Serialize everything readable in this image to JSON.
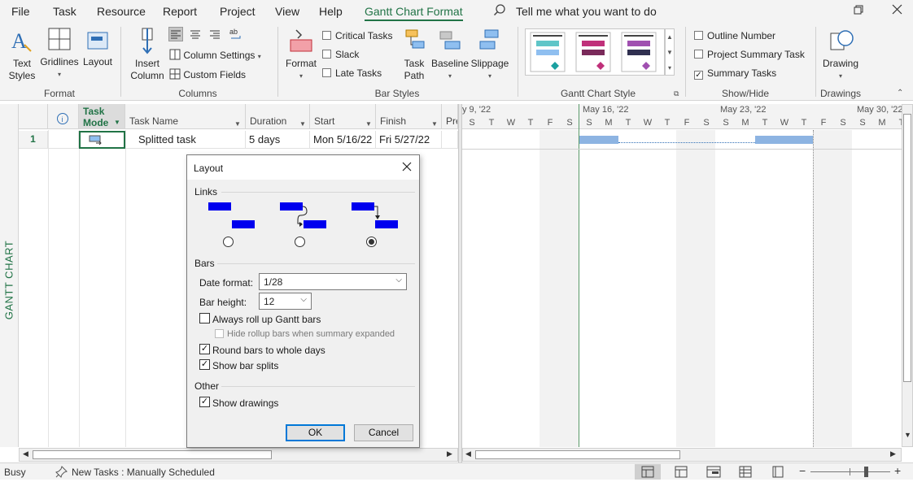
{
  "menu": {
    "items": [
      "File",
      "Task",
      "Resource",
      "Report",
      "Project",
      "View",
      "Help",
      "Gantt Chart Format"
    ],
    "tell_me": "Tell me what you want to do"
  },
  "ribbon": {
    "format_group": {
      "label": "Format",
      "text_styles": "Text\nStyles",
      "gridlines": "Gridlines",
      "layout": "Layout"
    },
    "columns_group": {
      "label": "Columns",
      "insert_column": "Insert\nColumn",
      "column_settings": "Column Settings",
      "custom_fields": "Custom Fields"
    },
    "bar_styles_group": {
      "label": "Bar Styles",
      "format": "Format",
      "critical_tasks": "Critical Tasks",
      "slack": "Slack",
      "late_tasks": "Late Tasks",
      "task_path": "Task\nPath",
      "baseline": "Baseline",
      "slippage": "Slippage"
    },
    "gantt_style_group": {
      "label": "Gantt Chart Style"
    },
    "show_hide_group": {
      "label": "Show/Hide",
      "outline_number": "Outline Number",
      "project_summary_task": "Project Summary Task",
      "summary_tasks": "Summary Tasks",
      "summary_tasks_checked": true
    },
    "drawings_group": {
      "label": "Drawings",
      "drawing": "Drawing"
    }
  },
  "side_label": "GANTT CHART",
  "table": {
    "headers": [
      "Task\nMode",
      "Task Name",
      "Duration",
      "Start",
      "Finish",
      "Pre"
    ],
    "rows": [
      {
        "id": "1",
        "name": "Splitted task",
        "duration": "5 days",
        "start": "Mon 5/16/22",
        "finish": "Fri 5/27/22"
      }
    ]
  },
  "timeline": {
    "weeks": [
      "y 9, '22",
      "May 16, '22",
      "May 23, '22",
      "May 30, '22"
    ],
    "days": [
      "S",
      "T",
      "W",
      "T",
      "F",
      "S",
      "S",
      "M",
      "T",
      "W",
      "T",
      "F",
      "S",
      "S",
      "M",
      "T",
      "W",
      "T",
      "F",
      "S",
      "S",
      "M",
      "T",
      "W"
    ]
  },
  "dialog": {
    "title": "Layout",
    "links_label": "Links",
    "links_selected": 3,
    "bars_label": "Bars",
    "date_format_label": "Date format:",
    "date_format_value": "1/28",
    "bar_height_label": "Bar height:",
    "bar_height_value": "12",
    "always_roll_up": "Always roll up Gantt bars",
    "hide_rollup": "Hide rollup bars when summary expanded",
    "round_bars": "Round bars to whole days",
    "show_bar_splits": "Show bar splits",
    "other_label": "Other",
    "show_drawings": "Show drawings",
    "ok": "OK",
    "cancel": "Cancel"
  },
  "status": {
    "busy": "Busy",
    "new_tasks": "New Tasks : Manually Scheduled"
  },
  "colors": {
    "accent": "#217346",
    "gantt_bar": "#8db4e2",
    "link_blue": "#0000ee"
  }
}
